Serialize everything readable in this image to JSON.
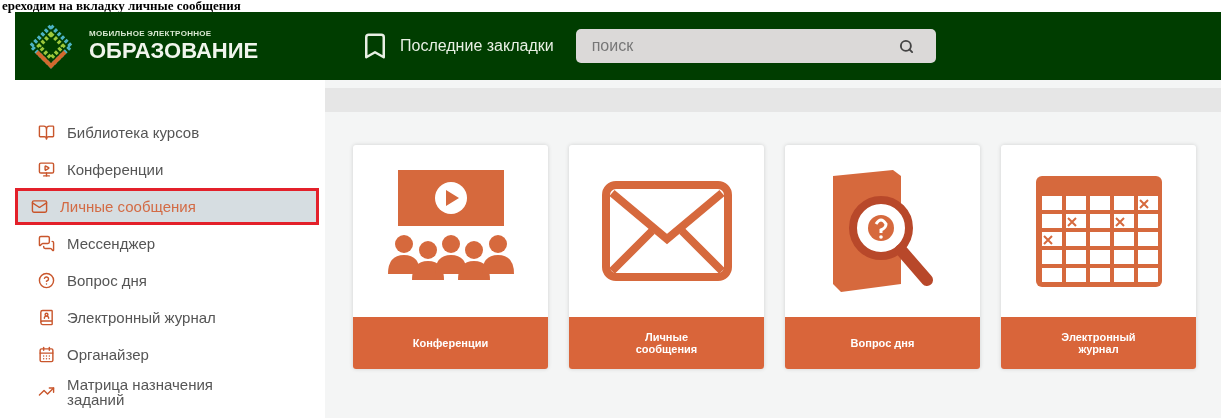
{
  "caption": "ереходим на вкладку личные сообщения",
  "header": {
    "logo_top": "МОБИЛЬНОЕ ЭЛЕКТРОННОЕ",
    "logo_main": "ОБРАЗОВАНИЕ",
    "bookmarks": "Последние закладки",
    "search": {
      "placeholder": "поиск"
    }
  },
  "sidebar": {
    "items": [
      {
        "kind": "library",
        "label": "Библиотека курсов",
        "selected": false
      },
      {
        "kind": "conference",
        "label": "Конференции",
        "selected": false
      },
      {
        "kind": "mail",
        "label": "Личные сообщения",
        "selected": true
      },
      {
        "kind": "messenger",
        "label": "Мессенджер",
        "selected": false
      },
      {
        "kind": "question",
        "label": "Вопрос дня",
        "selected": false
      },
      {
        "kind": "journal",
        "label": "Электронный журнал",
        "selected": false
      },
      {
        "kind": "organizer",
        "label": "Органайзер",
        "selected": false
      },
      {
        "kind": "matrix",
        "label": "Матрица назначения заданий",
        "selected": false
      }
    ]
  },
  "tiles": [
    {
      "kind": "conference",
      "label": "Конференции"
    },
    {
      "kind": "mail",
      "label": "Личные сообщения"
    },
    {
      "kind": "question",
      "label": "Вопрос дня"
    },
    {
      "kind": "journal",
      "label": "Электронный журнал"
    }
  ]
}
